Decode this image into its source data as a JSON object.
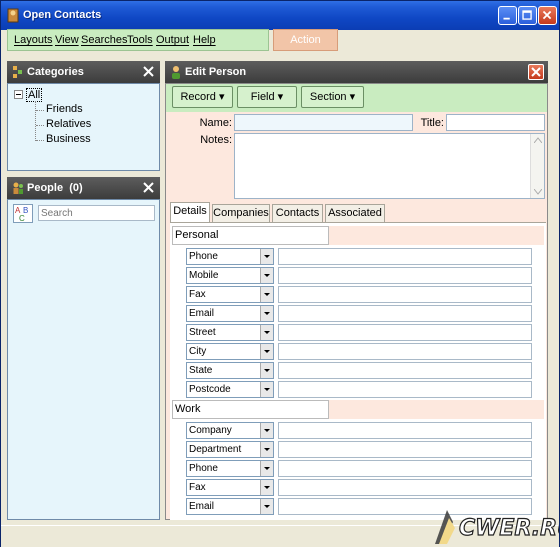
{
  "window": {
    "title": "Open Contacts"
  },
  "menu": {
    "items": [
      "Layouts",
      "View",
      "Searches",
      "Tools",
      "Output",
      "Help"
    ],
    "action_label": "Action"
  },
  "categories": {
    "title": "Categories",
    "root": "All",
    "children": [
      "Friends",
      "Relatives",
      "Business"
    ]
  },
  "people": {
    "title": "People",
    "count": "(0)",
    "search_placeholder": "Search"
  },
  "edit_person": {
    "title": "Edit Person",
    "toolbar": {
      "record": "Record",
      "field": "Field",
      "section": "Section"
    },
    "name_label": "Name:",
    "title_label": "Title:",
    "notes_label": "Notes:",
    "tabs": [
      "Details",
      "Companies",
      "Contacts",
      "Associated"
    ],
    "sections": [
      {
        "name": "Personal",
        "fields": [
          "Phone",
          "Mobile",
          "Fax",
          "Email",
          "Street",
          "City",
          "State",
          "Postcode"
        ]
      },
      {
        "name": "Work",
        "fields": [
          "Company",
          "Department",
          "Phone",
          "Fax",
          "Email"
        ]
      }
    ]
  },
  "watermark": "CWER.RU",
  "colors": {
    "titlebar": "#0f47c4",
    "toolbar_green": "#c9ecc0",
    "panel_bg": "#fde8de",
    "list_bg": "#e6f5fb"
  }
}
